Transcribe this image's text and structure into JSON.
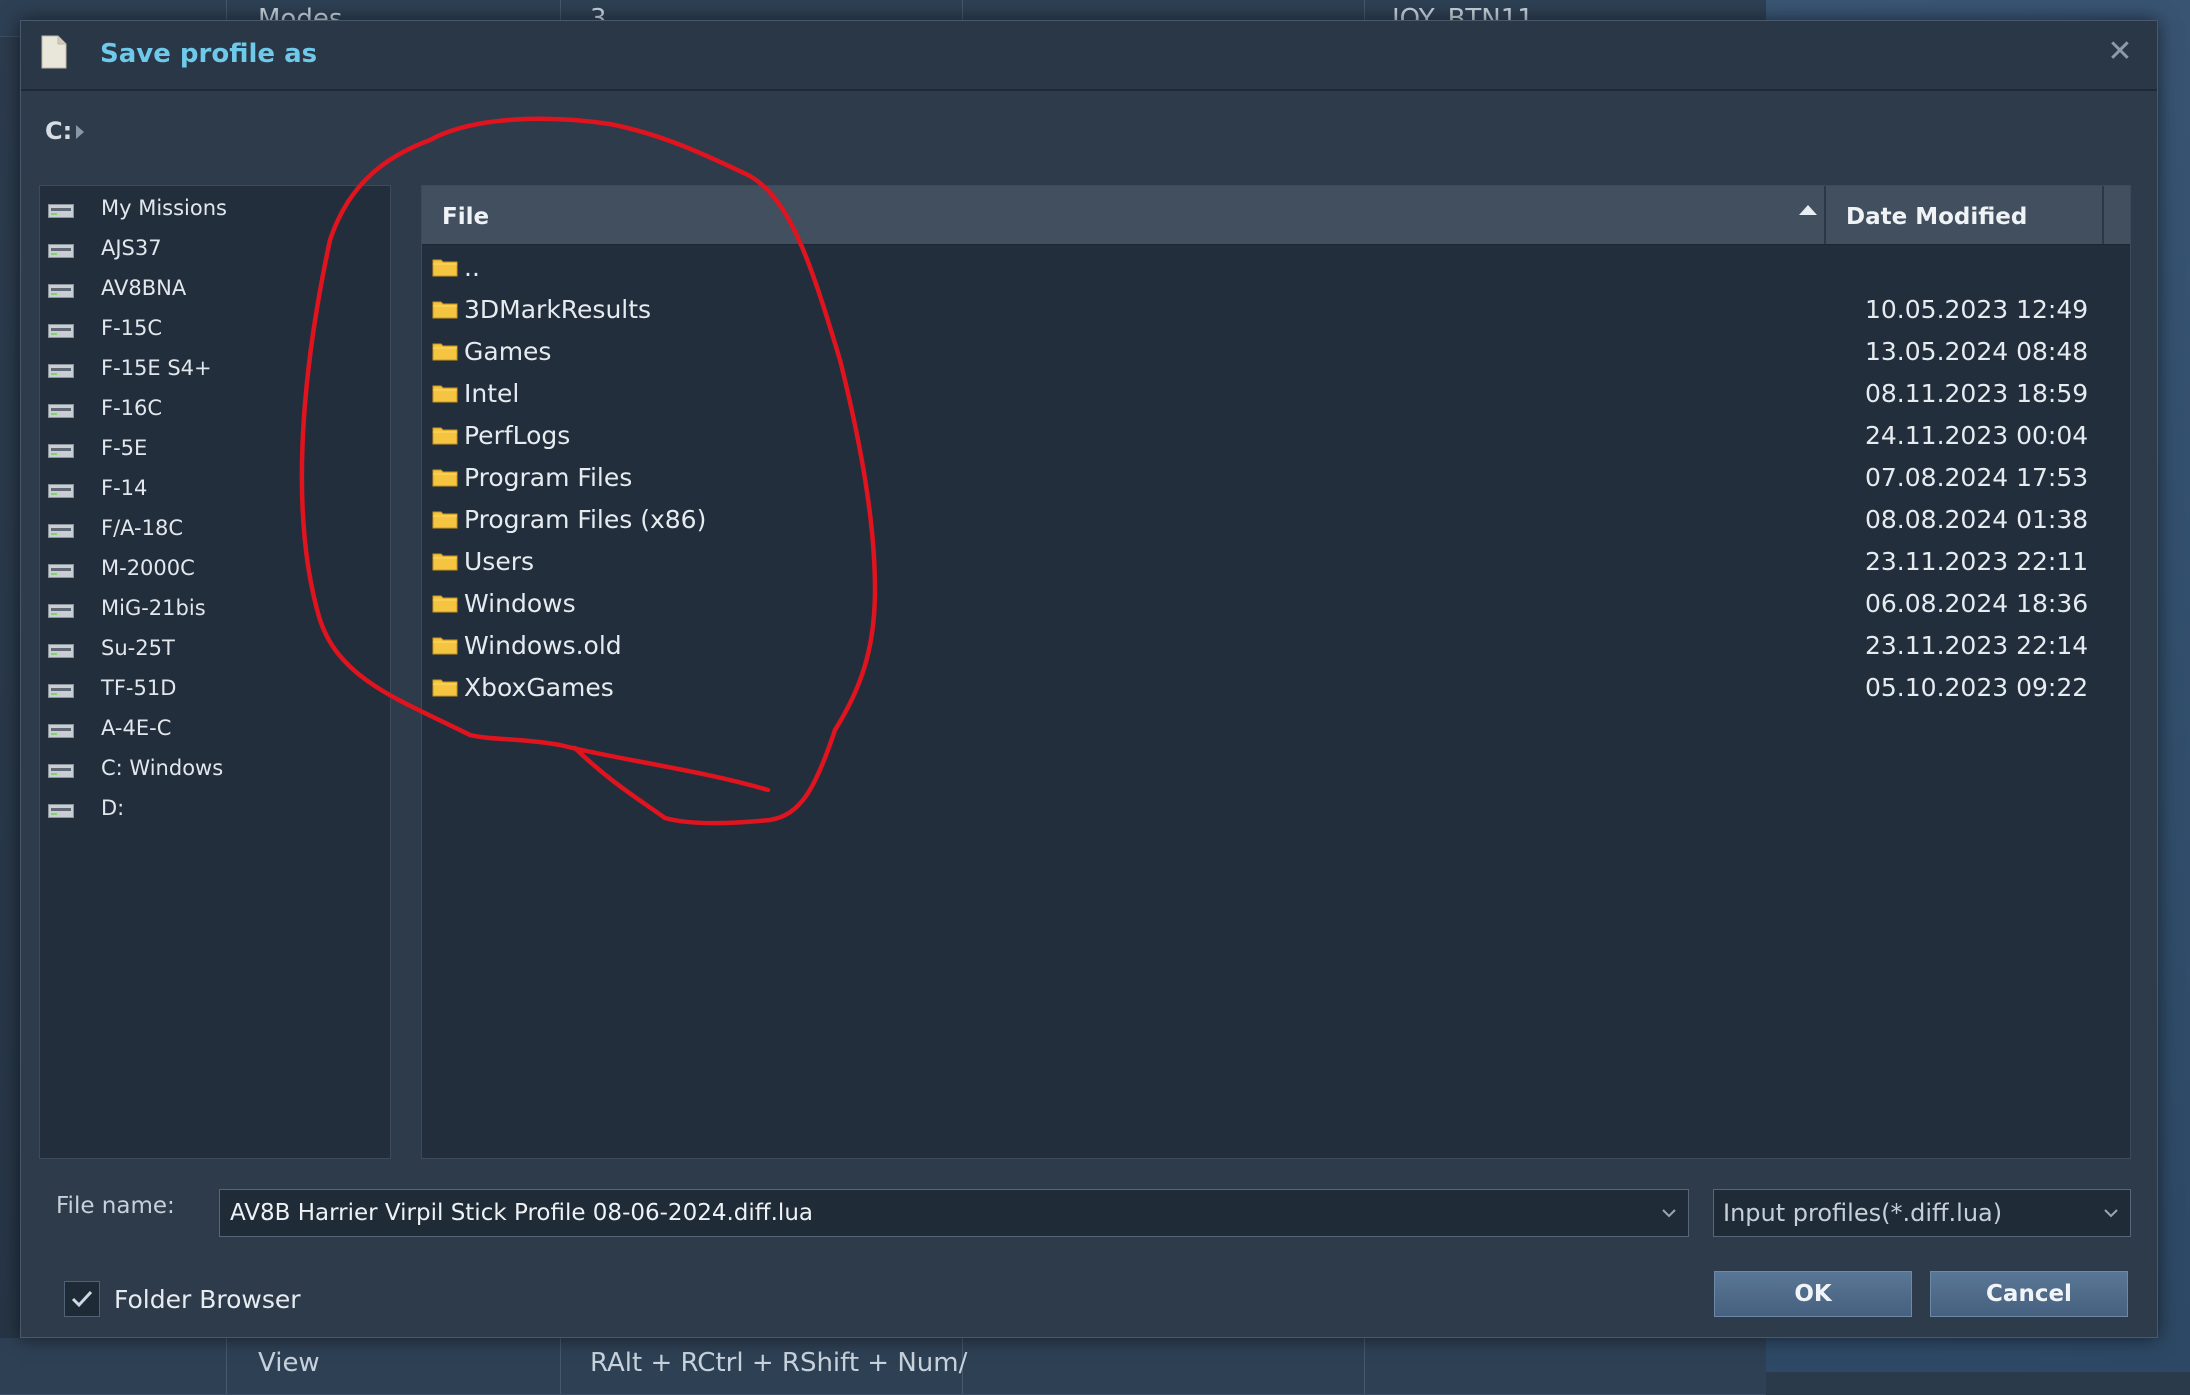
{
  "background": {
    "top_row": [
      "Modes",
      "3",
      "JOY_BTN11"
    ],
    "bottom_row": [
      "View",
      "RAlt + RCtrl + RShift + Num/"
    ]
  },
  "dialog": {
    "title": "Save profile as",
    "close_glyph": "✕",
    "title_icon": "document-icon"
  },
  "path": {
    "drive": "C:"
  },
  "sidebar": {
    "items": [
      {
        "label": "My Missions"
      },
      {
        "label": "AJS37"
      },
      {
        "label": "AV8BNA"
      },
      {
        "label": "F-15C"
      },
      {
        "label": "F-15E S4+"
      },
      {
        "label": "F-16C"
      },
      {
        "label": "F-5E"
      },
      {
        "label": "F-14"
      },
      {
        "label": "F/A-18C"
      },
      {
        "label": "M-2000C"
      },
      {
        "label": "MiG-21bis"
      },
      {
        "label": "Su-25T"
      },
      {
        "label": "TF-51D"
      },
      {
        "label": "A-4E-C"
      },
      {
        "label": "C: Windows"
      },
      {
        "label": "D:"
      }
    ]
  },
  "file_list": {
    "columns": {
      "file": "File",
      "date": "Date Modified"
    },
    "sort": "file-ascending",
    "rows": [
      {
        "name": "..",
        "date": ""
      },
      {
        "name": "3DMarkResults",
        "date": "10.05.2023 12:49"
      },
      {
        "name": "Games",
        "date": "13.05.2024 08:48"
      },
      {
        "name": "Intel",
        "date": "08.11.2023 18:59"
      },
      {
        "name": "PerfLogs",
        "date": "24.11.2023 00:04"
      },
      {
        "name": "Program Files",
        "date": "07.08.2024 17:53"
      },
      {
        "name": "Program Files (x86)",
        "date": "08.08.2024 01:38"
      },
      {
        "name": "Users",
        "date": "23.11.2023 22:11"
      },
      {
        "name": "Windows",
        "date": "06.08.2024 18:36"
      },
      {
        "name": "Windows.old",
        "date": "23.11.2023 22:14"
      },
      {
        "name": "XboxGames",
        "date": "05.10.2023 09:22"
      }
    ]
  },
  "footer": {
    "file_name_label": "File name:",
    "file_name_value": "AV8B Harrier Virpil Stick Profile 08-06-2024.diff.lua",
    "file_type": "Input profiles(*.diff.lua)",
    "folder_browser_label": "Folder Browser",
    "folder_browser_checked": true,
    "ok_label": "OK",
    "cancel_label": "Cancel"
  },
  "colors": {
    "title": "#6fc9ea",
    "annotation": "#e0141e",
    "folder": "#f5c542",
    "button": "#4f6b8a"
  }
}
